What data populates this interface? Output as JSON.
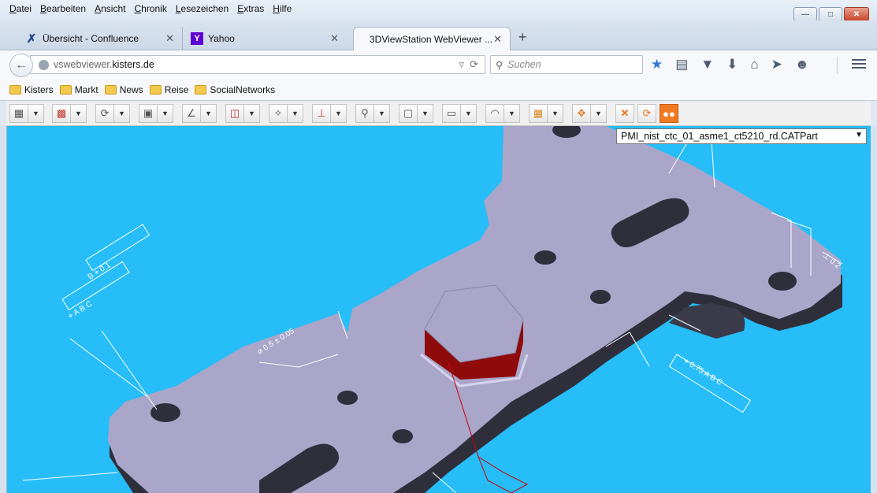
{
  "menu": {
    "items": [
      {
        "u": "D",
        "rest": "atei"
      },
      {
        "u": "B",
        "rest": "earbeiten"
      },
      {
        "u": "A",
        "rest": "nsicht"
      },
      {
        "u": "C",
        "rest": "hronik"
      },
      {
        "u": "L",
        "rest": "esezeichen"
      },
      {
        "u": "E",
        "rest": "xtras"
      },
      {
        "u": "H",
        "rest": "ilfe"
      }
    ]
  },
  "tabs": [
    {
      "label": "Übersicht - Confluence",
      "icon": "confluence-icon"
    },
    {
      "label": "Yahoo",
      "icon": "yahoo-icon"
    },
    {
      "label": "3DViewStation WebViewer ...",
      "icon": ""
    }
  ],
  "nav": {
    "url_prefix": "vswebviewer.",
    "url_domain": "kisters.de",
    "search_placeholder": "Suchen"
  },
  "bookmarks": [
    "Kisters",
    "Markt",
    "News",
    "Reise",
    "SocialNetworks"
  ],
  "viewer": {
    "part_name": "PMI_nist_ctc_01_asme1_ct5210_rd.CATPart",
    "background": "#26bdf8",
    "part_color": "#a9a6c9",
    "part_shadow": "#3a3a4a",
    "hex_color": "#8f0b0b"
  },
  "toolbar": {
    "icons": [
      "select-icon",
      "layers-icon",
      "rotate-icon",
      "view-cube-icon",
      "measure-icon",
      "section-icon",
      "fit-icon",
      "axes-icon",
      "zoom-icon",
      "box-icon",
      "wireframe-icon",
      "explode-icon",
      "parts-icon",
      "move-icon",
      "clear-icon",
      "refresh-icon",
      "pmi-icon"
    ]
  }
}
